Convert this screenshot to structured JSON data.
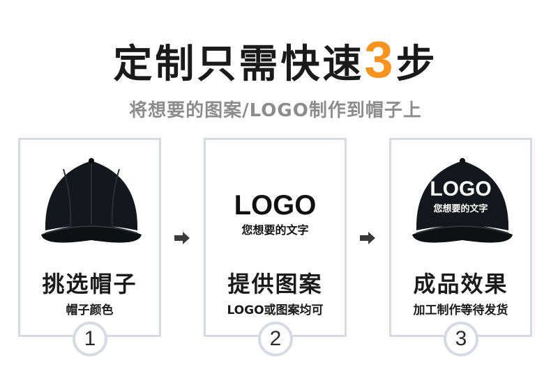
{
  "header": {
    "title_part1": "定制只需快速",
    "title_number": "3",
    "title_part2": "步",
    "subtitle": "将想要的图案/LOGO制作到帽子上"
  },
  "steps": [
    {
      "title": "挑选帽子",
      "subtitle": "帽子颜色",
      "number": "1",
      "image": "black-cap-icon"
    },
    {
      "title": "提供图案",
      "subtitle": "LOGO或图案均可",
      "number": "2",
      "logo_text": "LOGO",
      "logo_caption": "您想要的文字"
    },
    {
      "title": "成品效果",
      "subtitle": "加工制作等待发货",
      "number": "3",
      "image": "black-cap-with-logo-icon",
      "logo_text": "LOGO",
      "logo_caption": "您想要的文字"
    }
  ],
  "colors": {
    "accent": "#f7931e",
    "text": "#1a1a1a",
    "subtitle": "#8c8c8c",
    "card_border": "#d5dae3",
    "arrow": "#3a3a3a"
  }
}
